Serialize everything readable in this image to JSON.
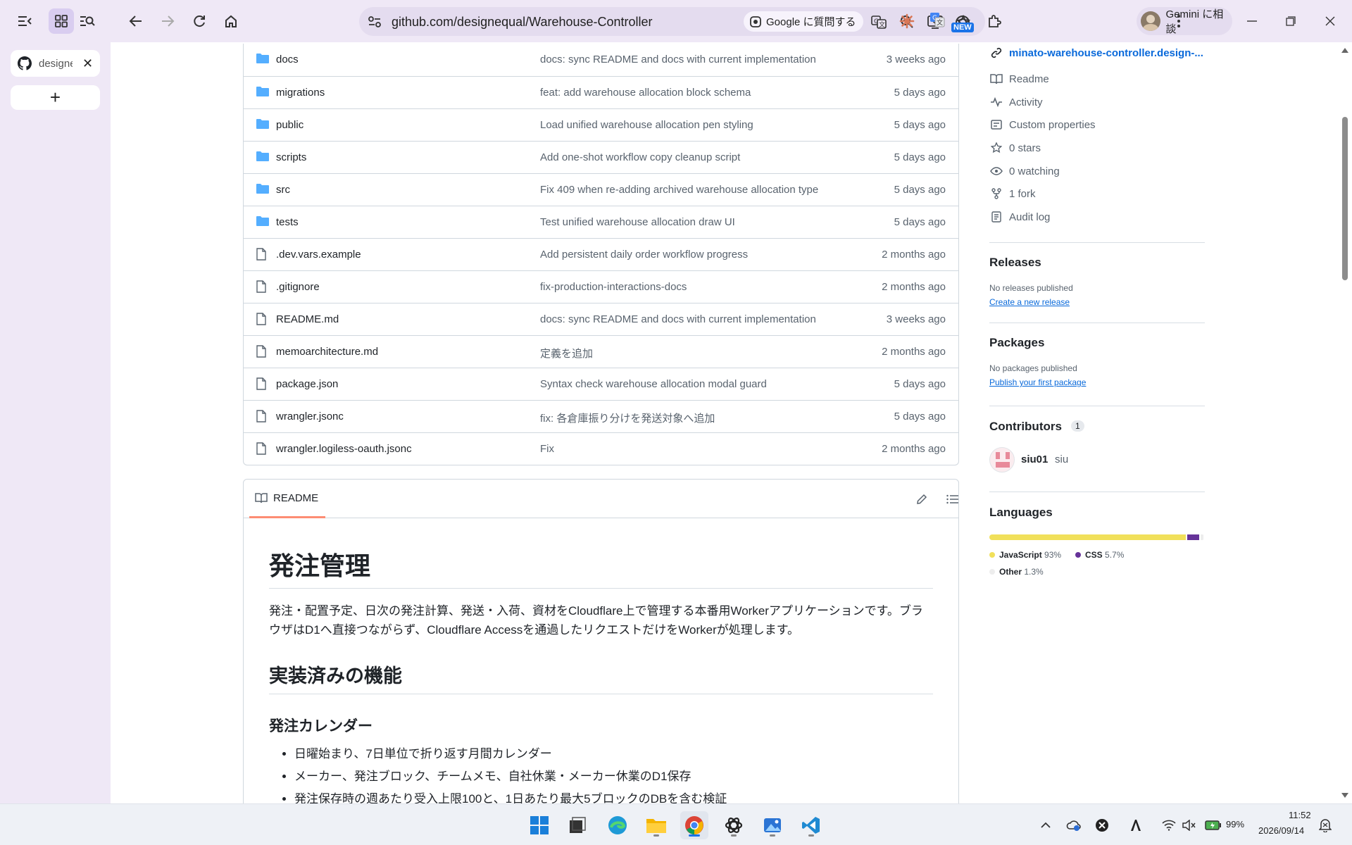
{
  "browser": {
    "url": "github.com/designequal/Warehouse-Controller",
    "tab_title": "designe",
    "google_ask_label": "Google に質問する",
    "gemini_label": "Gemini に相談",
    "new_badge": "NEW"
  },
  "files": [
    {
      "type": "folder",
      "name": "docs",
      "message": "docs: sync README and docs with current implementation",
      "time": "3 weeks ago"
    },
    {
      "type": "folder",
      "name": "migrations",
      "message": "feat: add warehouse allocation block schema",
      "time": "5 days ago"
    },
    {
      "type": "folder",
      "name": "public",
      "message": "Load unified warehouse allocation pen styling",
      "time": "5 days ago"
    },
    {
      "type": "folder",
      "name": "scripts",
      "message": "Add one-shot workflow copy cleanup script",
      "time": "5 days ago"
    },
    {
      "type": "folder",
      "name": "src",
      "message": "Fix 409 when re-adding archived warehouse allocation type",
      "time": "5 days ago"
    },
    {
      "type": "folder",
      "name": "tests",
      "message": "Test unified warehouse allocation draw UI",
      "time": "5 days ago"
    },
    {
      "type": "file",
      "name": ".dev.vars.example",
      "message": "Add persistent daily order workflow progress",
      "time": "2 months ago"
    },
    {
      "type": "file",
      "name": ".gitignore",
      "message": "fix-production-interactions-docs",
      "time": "2 months ago"
    },
    {
      "type": "file",
      "name": "README.md",
      "message": "docs: sync README and docs with current implementation",
      "time": "3 weeks ago"
    },
    {
      "type": "file",
      "name": "memoarchitecture.md",
      "message": "定義を追加",
      "time": "2 months ago"
    },
    {
      "type": "file",
      "name": "package.json",
      "message": "Syntax check warehouse allocation modal guard",
      "time": "5 days ago"
    },
    {
      "type": "file",
      "name": "wrangler.jsonc",
      "message": "fix: 各倉庫振り分けを発送対象へ追加",
      "time": "5 days ago"
    },
    {
      "type": "file",
      "name": "wrangler.logiless-oauth.jsonc",
      "message": "Fix",
      "time": "2 months ago"
    }
  ],
  "readme": {
    "tab_label": "README",
    "h1": "発注管理",
    "intro": "発注・配置予定、日次の発注計算、発送・入荷、資材をCloudflare上で管理する本番用Workerアプリケーションです。ブラウザはD1へ直接つながらず、Cloudflare Accessを通過したリクエストだけをWorkerが処理します。",
    "h2": "実装済みの機能",
    "h3": "発注カレンダー",
    "list": [
      "日曜始まり、7日単位で折り返す月間カレンダー",
      "メーカー、発注ブロック、チームメモ、自社休業・メーカー休業のD1保存",
      "発注保存時の週あたり受入上限100と、1日あたり最大5ブロックのDBを含む検証"
    ]
  },
  "sidebar": {
    "website": "minato-warehouse-controller.design-...",
    "links": [
      "Readme",
      "Activity",
      "Custom properties",
      "0 stars",
      "0 watching",
      "1 fork",
      "Audit log"
    ],
    "releases_title": "Releases",
    "releases_none": "No releases published",
    "releases_create": "Create a new release",
    "packages_title": "Packages",
    "packages_none": "No packages published",
    "packages_publish": "Publish your first package",
    "contributors_title": "Contributors",
    "contributors_count": "1",
    "contributor_login": "siu01",
    "contributor_name": "siu",
    "languages_title": "Languages",
    "languages": [
      {
        "name": "JavaScript",
        "pct": "93%",
        "value": 93,
        "color": "#f1e05a"
      },
      {
        "name": "CSS",
        "pct": "5.7%",
        "value": 5.7,
        "color": "#663399"
      },
      {
        "name": "Other",
        "pct": "1.3%",
        "value": 1.3,
        "color": "#ededed"
      }
    ]
  },
  "taskbar": {
    "battery": "99%",
    "time": "11:52",
    "date": "2026/09/14"
  }
}
